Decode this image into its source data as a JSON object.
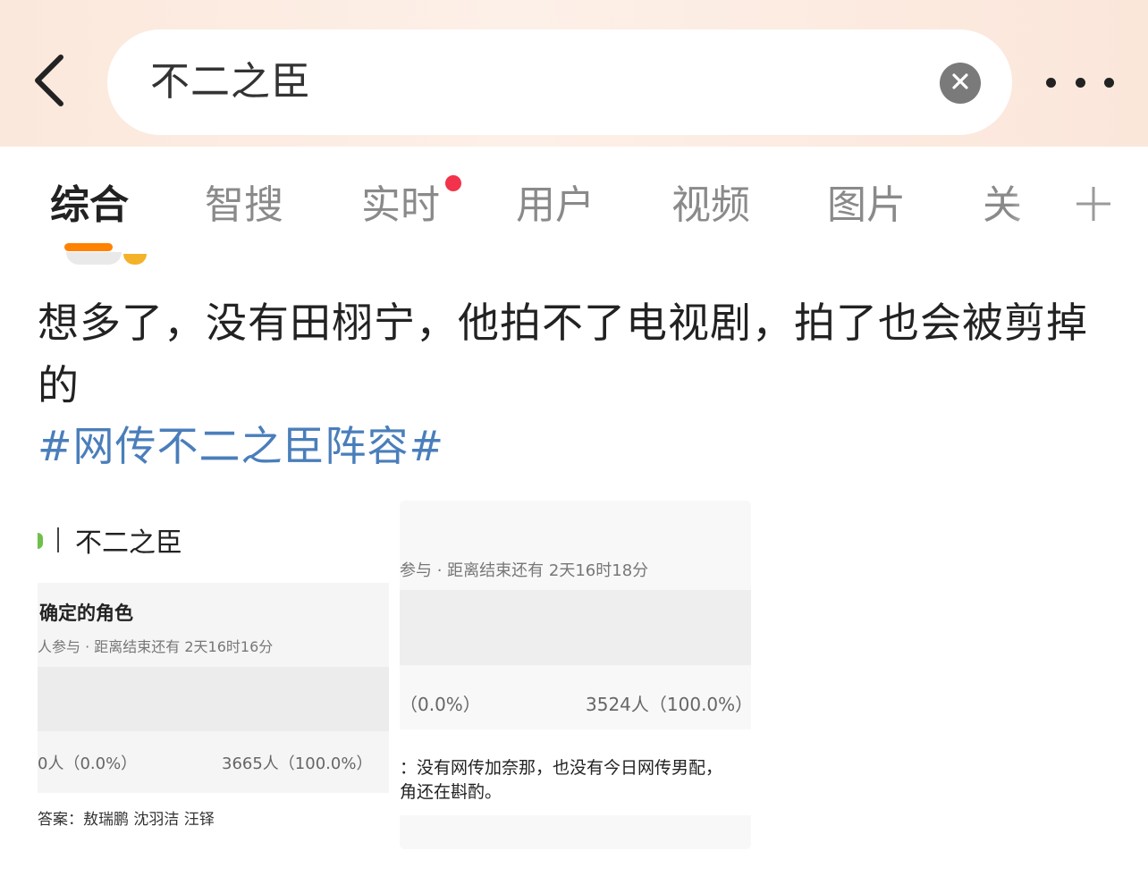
{
  "search": {
    "query": "不二之臣"
  },
  "tabs": [
    {
      "label": "综合"
    },
    {
      "label": "智搜"
    },
    {
      "label": "实时"
    },
    {
      "label": "用户"
    },
    {
      "label": "视频"
    },
    {
      "label": "图片"
    },
    {
      "label": "关"
    }
  ],
  "colors": {
    "accent": "#ff8200",
    "hashtag": "#4a7ebb",
    "notification_dot": "#f2334b"
  },
  "icons": {
    "back": "chevron-left-icon",
    "clear": "close-icon",
    "more": "more-dots-icon",
    "add_tab": "plus-icon"
  },
  "post": {
    "text": "想多了，没有田栩宁，他拍不了电视剧，拍了也会被剪掉的",
    "hashtag": "#网传不二之臣阵容#"
  },
  "images": [
    {
      "title": "不二之臣",
      "question": "确定的角色",
      "meta": "人参与 · 距离结束还有 2天16时16分",
      "option_left": "0人（0.0%）",
      "option_right": "3665人（100.0%）",
      "answer": "答案：敖瑞鹏 沈羽洁 汪铎"
    },
    {
      "meta": "参与 · 距离结束还有 2天16时18分",
      "option_left": "（0.0%）",
      "option_right": "3524人（100.0%）",
      "comment_line1": "：没有网传加奈那，也没有今日网传男配，",
      "comment_line2": "角还在斟酌。"
    }
  ]
}
